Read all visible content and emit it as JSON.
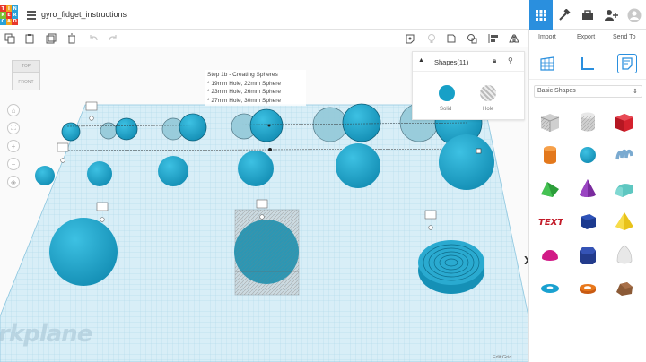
{
  "app": {
    "title": "gyro_fidget_instructions",
    "logo_letters": [
      "TIN",
      "KER",
      "CAD"
    ]
  },
  "topbar": {
    "icons": [
      "grid-view-icon",
      "hammer-icon",
      "toolbox-icon",
      "add-user-icon"
    ]
  },
  "toolbar": {
    "import_label": "Import",
    "export_label": "Export",
    "send_to_label": "Send To"
  },
  "viewcube": {
    "top": "TOP",
    "front": "FRONT"
  },
  "note": {
    "heading": "Step 1b - Creating Spheres",
    "lines": [
      "* 19mm Hole, 22mm Sphere",
      "* 23mm Hole, 26mm Sphere",
      "* 27mm Hole, 30mm Sphere"
    ]
  },
  "inspector": {
    "title": "Shapes(11)",
    "solid_label": "Solid",
    "hole_label": "Hole",
    "solid_color": "#17a0c7"
  },
  "workplane": {
    "watermark": "rkplane",
    "edit_grid": "Edit Grid",
    "color": "#d8eef7",
    "shape_color": "#17a0c7"
  },
  "rpanel": {
    "category": "Basic Shapes",
    "shapes": [
      "box-hole-shape",
      "cylinder-hole-shape",
      "box-shape",
      "cylinder-shape",
      "sphere-shape",
      "scribble-shape",
      "roof-shape",
      "cone-shape",
      "round-roof-shape",
      "text-shape",
      "cube-shape",
      "pyramid-shape",
      "half-sphere-shape",
      "polygon-shape",
      "paraboloid-shape",
      "torus-shape",
      "tube-shape",
      "rock-shape"
    ],
    "text_shape_label": "TEXT"
  }
}
